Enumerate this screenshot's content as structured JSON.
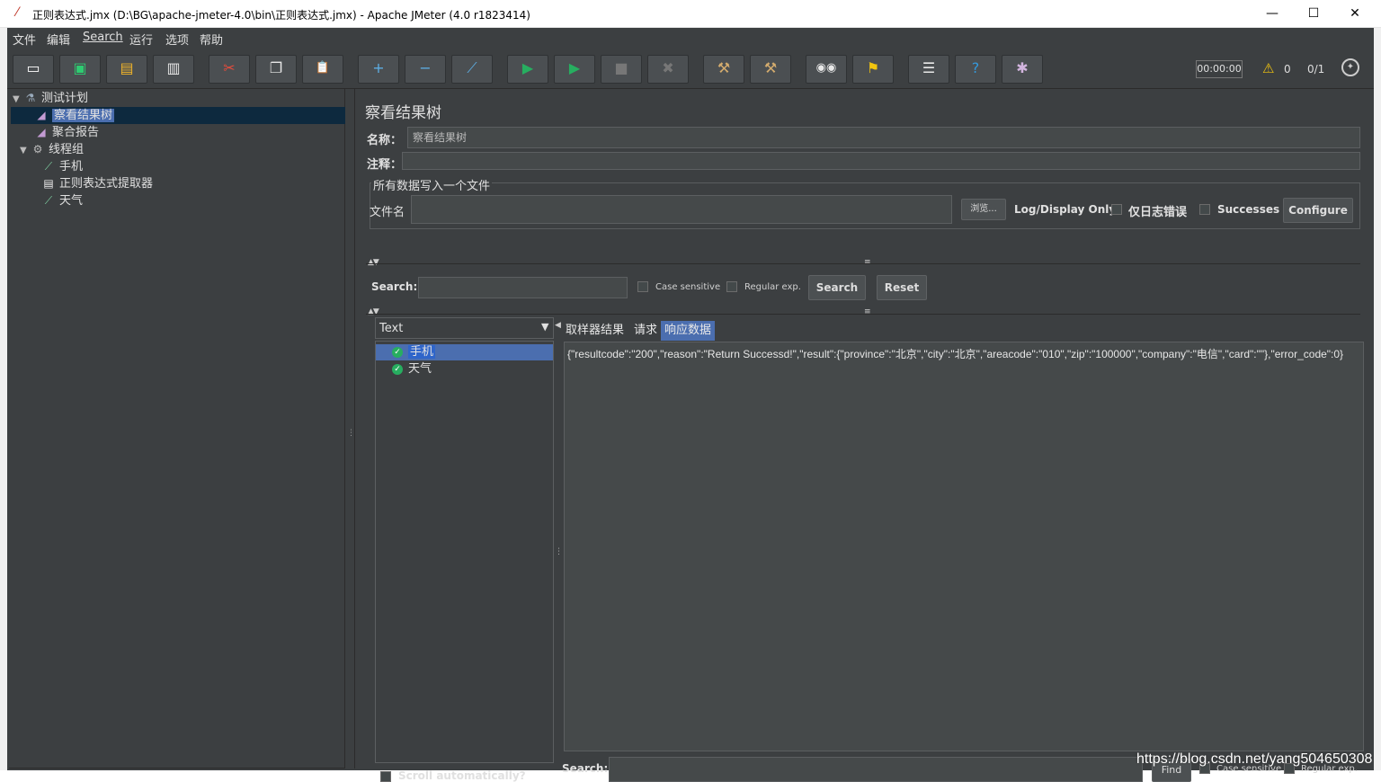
{
  "window": {
    "title": "正则表达式.jmx (D:\\BG\\apache-jmeter-4.0\\bin\\正则表达式.jmx) - Apache JMeter (4.0 r1823414)",
    "minimize": "—",
    "maximize": "☐",
    "close": "✕"
  },
  "menu": [
    "文件",
    "编辑",
    "Search",
    "运行",
    "选项",
    "帮助"
  ],
  "toolbar": {
    "icons": [
      "new-icon",
      "templates-icon",
      "open-icon",
      "save-icon",
      "cut-icon",
      "copy-icon",
      "paste-icon",
      "expand-icon",
      "collapse-icon",
      "toggle-icon",
      "start-icon",
      "start-no-pause-icon",
      "stop-icon",
      "shutdown-icon",
      "clear-icon",
      "clear-all-icon",
      "search-icon",
      "reset-search-icon",
      "function-helper-icon",
      "help-icon",
      "remote-icon"
    ],
    "glyphs": {
      "new": "▭",
      "templates": "▣",
      "open": "▤",
      "save": "▥",
      "cut": "✂",
      "copy": "❐",
      "paste": "📋",
      "expand": "+",
      "collapse": "−",
      "toggle": "⟋",
      "start": "▶",
      "start_np": "▶",
      "stop": "■",
      "shutdown": "✖",
      "clear": "⚒",
      "clear_all": "⚒",
      "search": "◉◉",
      "reset": "⚑",
      "function": "☰",
      "help": "?",
      "remote": "✱"
    },
    "timer": "00:00:00",
    "warnings": "0",
    "threads": "0/1"
  },
  "tree": {
    "root": "测试计划",
    "items": [
      {
        "label": "察看结果树",
        "icon": "chart-icon",
        "selected": true
      },
      {
        "label": "聚合报告",
        "icon": "chart-icon"
      },
      {
        "label": "线程组",
        "icon": "gear-icon"
      },
      {
        "label": "手机",
        "icon": "pipette-icon"
      },
      {
        "label": "正则表达式提取器",
        "icon": "document-icon"
      },
      {
        "label": "天气",
        "icon": "pipette-icon"
      }
    ]
  },
  "panel": {
    "title": "察看结果树",
    "name_label": "名称：",
    "name_value": "察看结果树",
    "comment_label": "注释：",
    "group_title": "所有数据写入一个文件",
    "filename_label": "文件名",
    "browse_label": "浏览...",
    "log_display_label": "Log/Display Only:",
    "errors_label": "仅日志错误",
    "successes_label": "Successes",
    "configure_label": "Configure",
    "search_label": "Search:",
    "case_sensitive": "Case sensitive",
    "regular_exp": "Regular exp.",
    "search_button": "Search",
    "reset_button": "Reset"
  },
  "results": {
    "renderer": "Text",
    "samples": [
      {
        "label": "手机",
        "selected": true
      },
      {
        "label": "天气"
      }
    ],
    "scroll_label": "Scroll automatically?",
    "tabs": [
      {
        "label": "取样器结果"
      },
      {
        "label": "请求"
      },
      {
        "label": "响应数据",
        "active": true
      }
    ],
    "response_text": "{\"resultcode\":\"200\",\"reason\":\"Return Successd!\",\"result\":{\"province\":\"北京\",\"city\":\"北京\",\"areacode\":\"010\",\"zip\":\"100000\",\"company\":\"电信\",\"card\":\"\"},\"error_code\":0}",
    "bottom_search_label": "Search:",
    "find_button": "Find",
    "case_sensitive": "Case sensitive",
    "regular_exp": "Regular exp."
  },
  "watermark": "https://blog.csdn.net/yang504650308"
}
